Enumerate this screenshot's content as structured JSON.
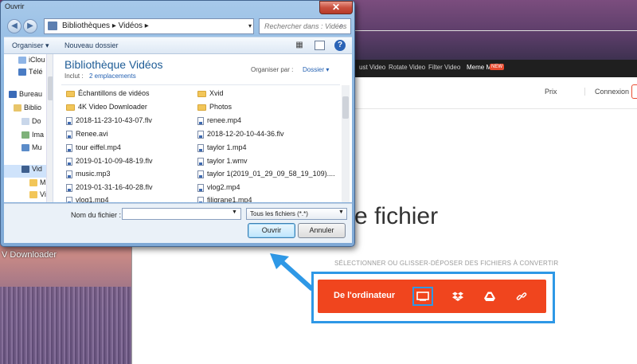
{
  "desktop": {
    "label": "V Downloader"
  },
  "browser": {
    "nav_items": [
      "ust Video",
      "Rotate Video",
      "Filter Video",
      "Meme Maker"
    ],
    "nav_badge": "NEW",
    "header": {
      "prix": "Prix",
      "connexion": "Connexion"
    },
    "hero_title": "vertisseur de fichier",
    "drop_hint": "SÉLECTIONNER OU GLISSER-DÉPOSER DES FICHIERS À CONVERTIR",
    "upload": {
      "from_computer": "De l'ordinateur",
      "icons": [
        "computer-icon",
        "dropbox-icon",
        "google-drive-icon",
        "link-icon"
      ],
      "accent_color": "#f0451e",
      "highlight_color": "#2e98e6"
    }
  },
  "dialog": {
    "title": "Ouvrir",
    "close_glyph": "✕",
    "address": "Bibliothèques ▸ Vidéos ▸",
    "search_placeholder": "Rechercher dans : Vidéos",
    "toolbar": {
      "organize": "Organiser ▾",
      "new_folder": "Nouveau dossier"
    },
    "nav_tree": [
      {
        "label": "iClou",
        "icon": "cloud-icon"
      },
      {
        "label": "Télé",
        "icon": "download-folder-icon"
      },
      {
        "label": "Bureau",
        "icon": "desktop-icon"
      },
      {
        "label": "Biblio",
        "icon": "library-icon"
      },
      {
        "label": "Do",
        "icon": "documents-icon"
      },
      {
        "label": "Ima",
        "icon": "pictures-icon"
      },
      {
        "label": "Mu",
        "icon": "music-icon"
      },
      {
        "label": "Vid",
        "icon": "videos-icon",
        "selected": true
      },
      {
        "label": "M",
        "icon": "folder-icon"
      },
      {
        "label": "Vi",
        "icon": "folder-icon"
      }
    ],
    "library": {
      "title": "Bibliothèque Vidéos",
      "include_label": "Inclut :",
      "include_link": "2 emplacements",
      "organize_label": "Organiser par :",
      "organize_value": "Dossier ▾"
    },
    "files_col1": [
      {
        "name": "Échantillons de vidéos",
        "type": "folder"
      },
      {
        "name": "4K Video Downloader",
        "type": "folder"
      },
      {
        "name": "2018-11-23-10-43-07.flv",
        "type": "file"
      },
      {
        "name": "Renee.avi",
        "type": "file"
      },
      {
        "name": "tour eiffel.mp4",
        "type": "file"
      },
      {
        "name": "2019-01-10-09-48-19.flv",
        "type": "file"
      },
      {
        "name": "music.mp3",
        "type": "file"
      },
      {
        "name": "2019-01-31-16-40-28.flv",
        "type": "file"
      },
      {
        "name": "vlog1.mp4",
        "type": "file"
      }
    ],
    "files_col2": [
      {
        "name": "Xvid",
        "type": "folder"
      },
      {
        "name": "Photos",
        "type": "folder"
      },
      {
        "name": "renee.mp4",
        "type": "file"
      },
      {
        "name": "2018-12-20-10-44-36.flv",
        "type": "file"
      },
      {
        "name": "taylor 1.mp4",
        "type": "file"
      },
      {
        "name": "taylor 1.wmv",
        "type": "file"
      },
      {
        "name": "taylor 1(2019_01_29_09_58_19_109)....",
        "type": "file"
      },
      {
        "name": "vlog2.mp4",
        "type": "file"
      },
      {
        "name": "filigrane1.mp4",
        "type": "file"
      }
    ],
    "bottom": {
      "filename_label": "Nom du fichier :",
      "filename_value": "",
      "file_type": "Tous les fichiers (*.*)",
      "open_button": "Ouvrir",
      "cancel_button": "Annuler"
    }
  }
}
